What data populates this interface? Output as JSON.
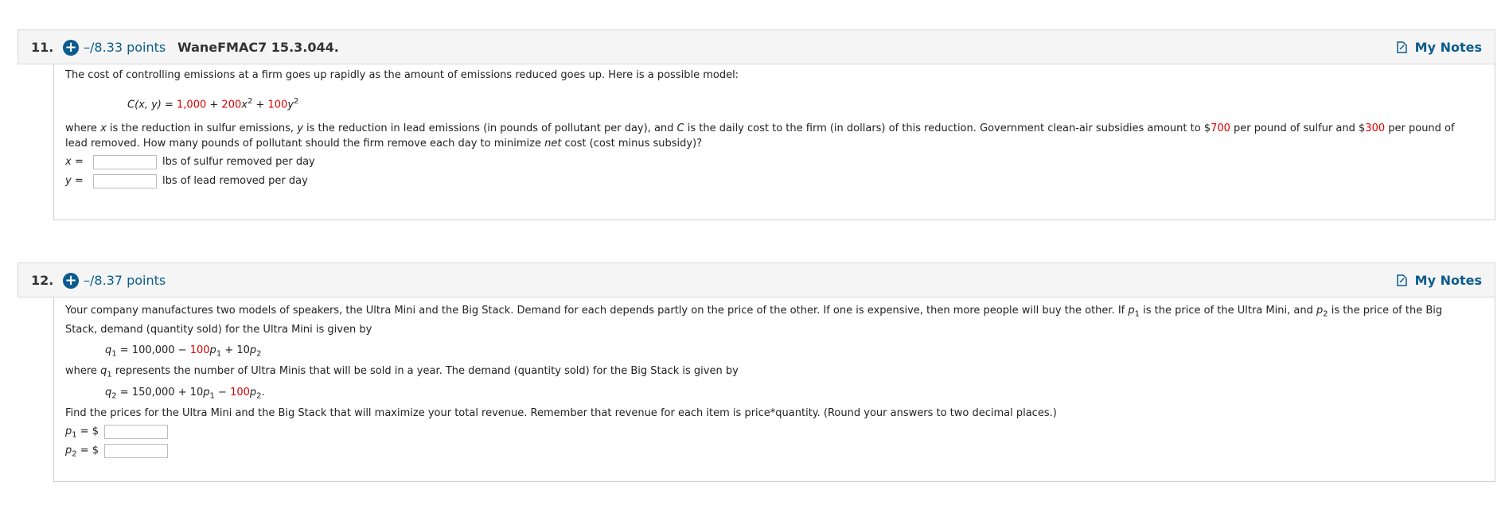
{
  "questions": [
    {
      "number": "11.",
      "points": "–/8.33 points",
      "id": "WaneFMAC7 15.3.044.",
      "notes_label": "My Notes",
      "intro": "The cost of controlling emissions at a firm goes up rapidly as the amount of emissions reduced goes up. Here is a possible model:",
      "model": {
        "lhs": "C(x, y) = ",
        "c0": "1,000",
        "c1": "200",
        "c2": "100"
      },
      "para_line1_a": "where ",
      "para_line1_b": " is the reduction in sulfur emissions, ",
      "para_line1_c": " is the reduction in lead emissions (in pounds of pollutant per day), and ",
      "para_line1_d": " is the daily cost to the firm (in dollars) of this reduction. Government clean-air subsidies amount to $",
      "subsidy_sulfur": "700",
      "para_line1_e": " per pound of sulfur and $",
      "subsidy_lead": "300",
      "para_line1_f": " per pound of",
      "para_line2_a": "lead removed. How many pounds of pollutant should the firm remove each day to minimize ",
      "para_line2_net": "net",
      "para_line2_b": " cost (cost minus subsidy)?",
      "answers": [
        {
          "var": "x",
          "eq": " = ",
          "value": "",
          "unit": "lbs of sulfur removed per day"
        },
        {
          "var": "y",
          "eq": " = ",
          "value": "",
          "unit": "lbs of lead removed per day"
        }
      ]
    },
    {
      "number": "12.",
      "points": "–/8.37 points",
      "notes_label": "My Notes",
      "intro_line1_a": "Your company manufactures two models of speakers, the Ultra Mini and the Big Stack. Demand for each depends partly on the price of the other. If one is expensive, then more people will buy the other. If ",
      "intro_line1_b": " is the price of the Ultra Mini, and ",
      "intro_line1_c": " is the price of the Big",
      "intro_line2": "Stack, demand (quantity sold) for the Ultra Mini is given by",
      "eq1": {
        "lhs": " = 100,000 − ",
        "coef_red": "100",
        "rest": " + 10"
      },
      "where_line_a": "where ",
      "where_line_b": " represents the number of Ultra Minis that will be sold in a year. The demand (quantity sold) for the Big Stack is given by",
      "eq2": {
        "lhs": " = 150,000 + 10",
        "minus": " − ",
        "coef_red": "100",
        "end": "."
      },
      "find_line": "Find the prices for the Ultra Mini and the Big Stack that will maximize your total revenue. Remember that revenue for each item is price*quantity. (Round your answers to two decimal places.)",
      "answers": [
        {
          "var": "p",
          "sub": "1",
          "eq": " = $",
          "value": ""
        },
        {
          "var": "p",
          "sub": "2",
          "eq": " = $",
          "value": ""
        }
      ]
    }
  ],
  "colors": {
    "link_blue": "#0b5c8d",
    "highlight_red": "#e00000",
    "header_bg": "#f5f5f5"
  }
}
